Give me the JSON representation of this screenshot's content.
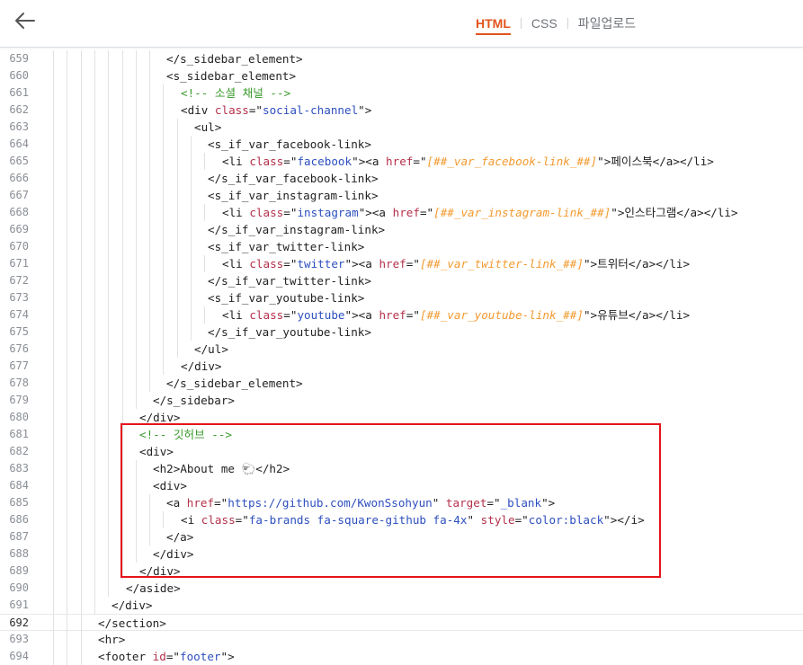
{
  "header": {
    "back_icon": "back-arrow-icon",
    "tabs": [
      {
        "label": "HTML",
        "active": true
      },
      {
        "label": "CSS",
        "active": false
      },
      {
        "label": "파일업로드",
        "active": false
      }
    ]
  },
  "colors": {
    "accent": "#e2531b",
    "tag": "#222222",
    "attribute": "#b4314b",
    "string": "#2d4fbf",
    "comment": "#3a9a2b",
    "variable": "#f39a30",
    "highlight_box": "#e5141a"
  },
  "editor": {
    "current_line": "692",
    "lines": [
      {
        "n": "659",
        "indent": 8,
        "parts": [
          [
            "t",
            "</s_sidebar_element>"
          ]
        ]
      },
      {
        "n": "660",
        "indent": 8,
        "parts": [
          [
            "t",
            "<s_sidebar_element>"
          ]
        ]
      },
      {
        "n": "661",
        "indent": 9,
        "parts": [
          [
            "c",
            "<!-- 소셜 채널 -->"
          ]
        ]
      },
      {
        "n": "662",
        "indent": 9,
        "parts": [
          [
            "t",
            "<div "
          ],
          [
            "a",
            "class"
          ],
          [
            "t",
            "=\""
          ],
          [
            "s",
            "social-channel"
          ],
          [
            "t",
            "\">"
          ]
        ]
      },
      {
        "n": "663",
        "indent": 10,
        "parts": [
          [
            "t",
            "<ul>"
          ]
        ]
      },
      {
        "n": "664",
        "indent": 11,
        "parts": [
          [
            "t",
            "<s_if_var_facebook-link>"
          ]
        ]
      },
      {
        "n": "665",
        "indent": 12,
        "parts": [
          [
            "t",
            "<li "
          ],
          [
            "a",
            "class"
          ],
          [
            "t",
            "=\""
          ],
          [
            "s",
            "facebook"
          ],
          [
            "t",
            "\"><a "
          ],
          [
            "a",
            "href"
          ],
          [
            "t",
            "=\""
          ],
          [
            "v",
            "[##_var_facebook-link_##]"
          ],
          [
            "t",
            "\">페이스북</a></li>"
          ]
        ]
      },
      {
        "n": "666",
        "indent": 11,
        "parts": [
          [
            "t",
            "</s_if_var_facebook-link>"
          ]
        ]
      },
      {
        "n": "667",
        "indent": 11,
        "parts": [
          [
            "t",
            "<s_if_var_instagram-link>"
          ]
        ]
      },
      {
        "n": "668",
        "indent": 12,
        "parts": [
          [
            "t",
            "<li "
          ],
          [
            "a",
            "class"
          ],
          [
            "t",
            "=\""
          ],
          [
            "s",
            "instagram"
          ],
          [
            "t",
            "\"><a "
          ],
          [
            "a",
            "href"
          ],
          [
            "t",
            "=\""
          ],
          [
            "v",
            "[##_var_instagram-link_##]"
          ],
          [
            "t",
            "\">인스타그램</a></li>"
          ]
        ]
      },
      {
        "n": "669",
        "indent": 11,
        "parts": [
          [
            "t",
            "</s_if_var_instagram-link>"
          ]
        ]
      },
      {
        "n": "670",
        "indent": 11,
        "parts": [
          [
            "t",
            "<s_if_var_twitter-link>"
          ]
        ]
      },
      {
        "n": "671",
        "indent": 12,
        "parts": [
          [
            "t",
            "<li "
          ],
          [
            "a",
            "class"
          ],
          [
            "t",
            "=\""
          ],
          [
            "s",
            "twitter"
          ],
          [
            "t",
            "\"><a "
          ],
          [
            "a",
            "href"
          ],
          [
            "t",
            "=\""
          ],
          [
            "v",
            "[##_var_twitter-link_##]"
          ],
          [
            "t",
            "\">트위터</a></li>"
          ]
        ]
      },
      {
        "n": "672",
        "indent": 11,
        "parts": [
          [
            "t",
            "</s_if_var_twitter-link>"
          ]
        ]
      },
      {
        "n": "673",
        "indent": 11,
        "parts": [
          [
            "t",
            "<s_if_var_youtube-link>"
          ]
        ]
      },
      {
        "n": "674",
        "indent": 12,
        "parts": [
          [
            "t",
            "<li "
          ],
          [
            "a",
            "class"
          ],
          [
            "t",
            "=\""
          ],
          [
            "s",
            "youtube"
          ],
          [
            "t",
            "\"><a "
          ],
          [
            "a",
            "href"
          ],
          [
            "t",
            "=\""
          ],
          [
            "v",
            "[##_var_youtube-link_##]"
          ],
          [
            "t",
            "\">유튜브</a></li>"
          ]
        ]
      },
      {
        "n": "675",
        "indent": 11,
        "parts": [
          [
            "t",
            "</s_if_var_youtube-link>"
          ]
        ]
      },
      {
        "n": "676",
        "indent": 10,
        "parts": [
          [
            "t",
            "</ul>"
          ]
        ]
      },
      {
        "n": "677",
        "indent": 9,
        "parts": [
          [
            "t",
            "</div>"
          ]
        ]
      },
      {
        "n": "678",
        "indent": 8,
        "parts": [
          [
            "t",
            "</s_sidebar_element>"
          ]
        ]
      },
      {
        "n": "679",
        "indent": 7,
        "parts": [
          [
            "t",
            "</s_sidebar>"
          ]
        ]
      },
      {
        "n": "680",
        "indent": 6,
        "parts": [
          [
            "t",
            "</div>"
          ]
        ]
      },
      {
        "n": "681",
        "indent": 6,
        "parts": [
          [
            "c",
            "<!-- 깃허브 -->"
          ]
        ]
      },
      {
        "n": "682",
        "indent": 6,
        "parts": [
          [
            "t",
            "<div>"
          ]
        ]
      },
      {
        "n": "683",
        "indent": 7,
        "parts": [
          [
            "t",
            "<h2>About me "
          ],
          [
            "e",
            "🐑"
          ],
          [
            "t",
            "</h2>"
          ]
        ]
      },
      {
        "n": "684",
        "indent": 7,
        "parts": [
          [
            "t",
            "<div>"
          ]
        ]
      },
      {
        "n": "685",
        "indent": 8,
        "parts": [
          [
            "t",
            "<a "
          ],
          [
            "a",
            "href"
          ],
          [
            "t",
            "=\""
          ],
          [
            "s",
            "https://github.com/KwonSsohyun"
          ],
          [
            "t",
            "\" "
          ],
          [
            "a",
            "target"
          ],
          [
            "t",
            "=\""
          ],
          [
            "s",
            "_blank"
          ],
          [
            "t",
            "\">"
          ]
        ]
      },
      {
        "n": "686",
        "indent": 9,
        "parts": [
          [
            "t",
            "<i "
          ],
          [
            "a",
            "class"
          ],
          [
            "t",
            "=\""
          ],
          [
            "s",
            "fa-brands fa-square-github fa-4x"
          ],
          [
            "t",
            "\" "
          ],
          [
            "a",
            "style"
          ],
          [
            "t",
            "=\""
          ],
          [
            "s",
            "color:black"
          ],
          [
            "t",
            "\"></i>"
          ]
        ]
      },
      {
        "n": "687",
        "indent": 8,
        "parts": [
          [
            "t",
            "</a>"
          ]
        ]
      },
      {
        "n": "688",
        "indent": 7,
        "parts": [
          [
            "t",
            "</div>"
          ]
        ]
      },
      {
        "n": "689",
        "indent": 6,
        "parts": [
          [
            "t",
            "</div>"
          ]
        ]
      },
      {
        "n": "690",
        "indent": 5,
        "parts": [
          [
            "t",
            "</aside>"
          ]
        ]
      },
      {
        "n": "691",
        "indent": 4,
        "parts": [
          [
            "t",
            "</div>"
          ]
        ]
      },
      {
        "n": "692",
        "indent": 3,
        "parts": [
          [
            "t",
            "</section>"
          ]
        ]
      },
      {
        "n": "693",
        "indent": 3,
        "parts": [
          [
            "t",
            "<hr>"
          ]
        ]
      },
      {
        "n": "694",
        "indent": 3,
        "parts": [
          [
            "t",
            "<footer "
          ],
          [
            "a",
            "id"
          ],
          [
            "t",
            "=\""
          ],
          [
            "s",
            "footer"
          ],
          [
            "t",
            "\">"
          ]
        ]
      }
    ]
  }
}
